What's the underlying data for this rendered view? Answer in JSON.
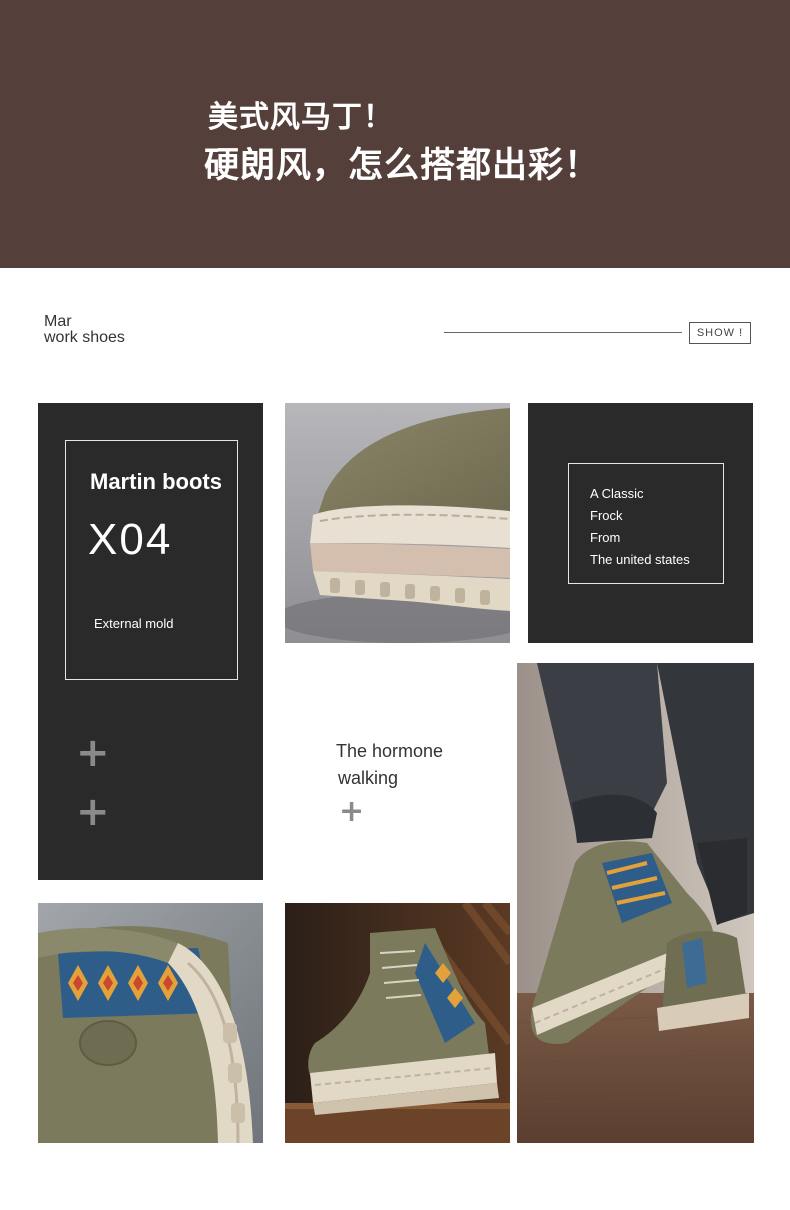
{
  "banner": {
    "line1": "美式风马丁！",
    "line2": "硬朗风，怎么搭都出彩！"
  },
  "header": {
    "tag_line1": "Mar",
    "tag_line2": "work shoes",
    "show_label": "SHOW !"
  },
  "panel_left": {
    "title": "Martin boots",
    "model": "X04",
    "caption": "External mold",
    "plus_icons": [
      "plus-icon",
      "plus-icon"
    ]
  },
  "panel_right": {
    "lines": [
      "A Classic",
      "Frock",
      "From",
      "The united states"
    ]
  },
  "middle": {
    "line1": "The hormone",
    "line2": "walking",
    "plus_icon": "plus-icon"
  },
  "colors": {
    "banner_bg": "#553f3a",
    "panel_bg": "#2a2a2a",
    "boot_olive": "#7b7a5c",
    "sole_cream": "#e2d8c6"
  }
}
